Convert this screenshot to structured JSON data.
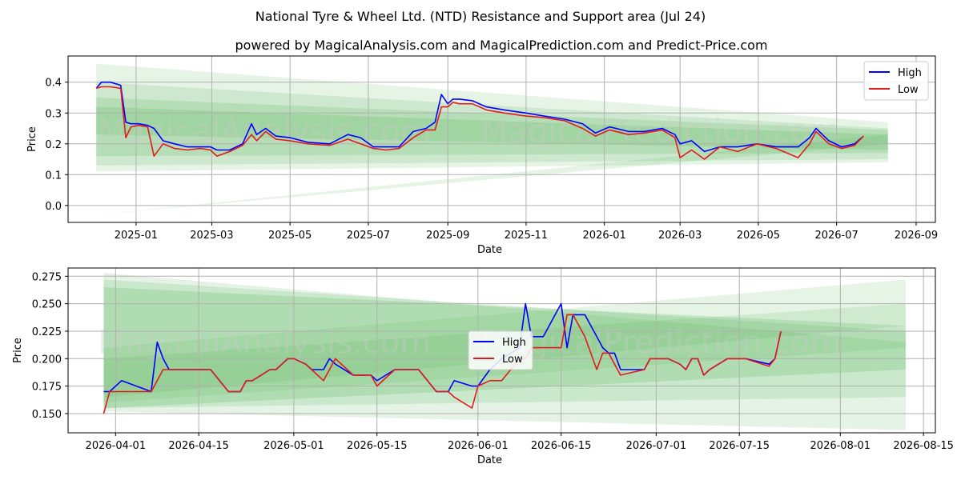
{
  "title": "National Tyre & Wheel Ltd. (NTD) Resistance and Support area (Jul 24)",
  "subtitle": "powered by MagicalAnalysis.com and MagicalPrediction.com and Predict-Price.com",
  "watermark_left": "MagicalAnalysis.com",
  "watermark_right": "MagicalPrediction.com",
  "colors": {
    "high": "#0000ff",
    "low": "#e31a1c",
    "band": "#4caf50",
    "grid": "#b0b0b0"
  },
  "chart_data": [
    {
      "type": "line",
      "xlabel": "Date",
      "ylabel": "Price",
      "ylim": [
        -0.055,
        0.485
      ],
      "xlim": [
        "2024-11-09",
        "2026-09-16"
      ],
      "yticks": [
        "0.0",
        "0.1",
        "0.2",
        "0.3",
        "0.4"
      ],
      "xticks": [
        "2025-01",
        "2025-03",
        "2025-05",
        "2025-07",
        "2025-09",
        "2025-11",
        "2026-01",
        "2026-03",
        "2026-05",
        "2026-07",
        "2026-09"
      ],
      "grid": true,
      "legend": {
        "position": "top-right",
        "entries": [
          "High",
          "Low"
        ]
      },
      "bands": [
        {
          "x0": "2024-12-01",
          "x1": "2026-08-10",
          "top0": 0.46,
          "top1": 0.27,
          "bot0": 0.11,
          "bot1": 0.14,
          "opacity": 0.14
        },
        {
          "x0": "2024-12-01",
          "x1": "2026-08-10",
          "top0": 0.4,
          "top1": 0.25,
          "bot0": 0.13,
          "bot1": 0.15,
          "opacity": 0.16
        },
        {
          "x0": "2024-12-01",
          "x1": "2026-08-10",
          "top0": 0.35,
          "top1": 0.245,
          "bot0": 0.16,
          "bot1": 0.17,
          "opacity": 0.18
        },
        {
          "x0": "2024-12-01",
          "x1": "2026-08-10",
          "top0": 0.32,
          "top1": 0.23,
          "bot0": 0.23,
          "bot1": 0.18,
          "opacity": 0.2
        },
        {
          "x0": "2024-12-01",
          "x1": "2026-08-10",
          "top0": -0.03,
          "top1": 0.23,
          "bot0": -0.03,
          "bot1": 0.2,
          "opacity": 0.14
        }
      ],
      "series": [
        {
          "name": "High",
          "x": [
            "2024-12-01",
            "2024-12-05",
            "2024-12-12",
            "2024-12-20",
            "2024-12-24",
            "2024-12-28",
            "2025-01-03",
            "2025-01-10",
            "2025-01-15",
            "2025-01-22",
            "2025-01-31",
            "2025-02-10",
            "2025-02-20",
            "2025-02-28",
            "2025-03-05",
            "2025-03-15",
            "2025-03-25",
            "2025-04-01",
            "2025-04-05",
            "2025-04-12",
            "2025-04-20",
            "2025-05-01",
            "2025-05-15",
            "2025-06-01",
            "2025-06-15",
            "2025-06-25",
            "2025-07-05",
            "2025-07-15",
            "2025-07-25",
            "2025-08-05",
            "2025-08-15",
            "2025-08-22",
            "2025-08-27",
            "2025-09-01",
            "2025-09-05",
            "2025-09-10",
            "2025-09-20",
            "2025-10-01",
            "2025-10-15",
            "2025-11-01",
            "2025-11-15",
            "2025-12-01",
            "2025-12-15",
            "2025-12-25",
            "2026-01-05",
            "2026-01-20",
            "2026-02-01",
            "2026-02-15",
            "2026-02-25",
            "2026-03-01",
            "2026-03-10",
            "2026-03-20",
            "2026-04-01",
            "2026-04-15",
            "2026-04-30",
            "2026-05-15",
            "2026-06-01",
            "2026-06-10",
            "2026-06-15",
            "2026-06-25",
            "2026-07-05",
            "2026-07-15",
            "2026-07-22"
          ],
          "values": [
            0.38,
            0.4,
            0.4,
            0.39,
            0.27,
            0.265,
            0.265,
            0.26,
            0.25,
            0.21,
            0.2,
            0.19,
            0.19,
            0.19,
            0.18,
            0.18,
            0.2,
            0.265,
            0.23,
            0.25,
            0.225,
            0.22,
            0.205,
            0.2,
            0.23,
            0.22,
            0.19,
            0.19,
            0.19,
            0.24,
            0.25,
            0.27,
            0.36,
            0.33,
            0.345,
            0.345,
            0.34,
            0.32,
            0.31,
            0.3,
            0.29,
            0.28,
            0.265,
            0.235,
            0.255,
            0.24,
            0.24,
            0.25,
            0.23,
            0.2,
            0.21,
            0.175,
            0.19,
            0.19,
            0.2,
            0.19,
            0.19,
            0.22,
            0.25,
            0.21,
            0.19,
            0.2,
            0.225
          ]
        },
        {
          "name": "Low",
          "x": [
            "2024-12-01",
            "2024-12-05",
            "2024-12-12",
            "2024-12-20",
            "2024-12-24",
            "2024-12-28",
            "2025-01-03",
            "2025-01-10",
            "2025-01-15",
            "2025-01-22",
            "2025-01-31",
            "2025-02-10",
            "2025-02-20",
            "2025-02-28",
            "2025-03-05",
            "2025-03-15",
            "2025-03-25",
            "2025-04-01",
            "2025-04-05",
            "2025-04-12",
            "2025-04-20",
            "2025-05-01",
            "2025-05-15",
            "2025-06-01",
            "2025-06-15",
            "2025-06-25",
            "2025-07-05",
            "2025-07-15",
            "2025-07-25",
            "2025-08-05",
            "2025-08-15",
            "2025-08-22",
            "2025-08-27",
            "2025-09-01",
            "2025-09-05",
            "2025-09-10",
            "2025-09-20",
            "2025-10-01",
            "2025-10-15",
            "2025-11-01",
            "2025-11-15",
            "2025-12-01",
            "2025-12-15",
            "2025-12-25",
            "2026-01-05",
            "2026-01-20",
            "2026-02-01",
            "2026-02-15",
            "2026-02-25",
            "2026-03-01",
            "2026-03-10",
            "2026-03-20",
            "2026-04-01",
            "2026-04-15",
            "2026-04-30",
            "2026-05-15",
            "2026-06-01",
            "2026-06-10",
            "2026-06-15",
            "2026-06-25",
            "2026-07-05",
            "2026-07-15",
            "2026-07-22"
          ],
          "values": [
            0.38,
            0.385,
            0.385,
            0.38,
            0.22,
            0.255,
            0.26,
            0.255,
            0.16,
            0.2,
            0.185,
            0.18,
            0.185,
            0.18,
            0.16,
            0.175,
            0.195,
            0.23,
            0.21,
            0.24,
            0.215,
            0.21,
            0.2,
            0.195,
            0.215,
            0.2,
            0.185,
            0.18,
            0.185,
            0.22,
            0.245,
            0.245,
            0.32,
            0.32,
            0.335,
            0.33,
            0.33,
            0.31,
            0.3,
            0.29,
            0.285,
            0.275,
            0.25,
            0.225,
            0.245,
            0.23,
            0.235,
            0.245,
            0.22,
            0.155,
            0.18,
            0.15,
            0.19,
            0.175,
            0.2,
            0.185,
            0.155,
            0.2,
            0.24,
            0.2,
            0.185,
            0.195,
            0.225
          ]
        }
      ]
    },
    {
      "type": "line",
      "xlabel": "Date",
      "ylabel": "Price",
      "ylim": [
        0.1325,
        0.2825
      ],
      "xlim": [
        "2026-03-24",
        "2026-08-17"
      ],
      "yticks": [
        "0.150",
        "0.175",
        "0.200",
        "0.225",
        "0.250",
        "0.275"
      ],
      "xticks": [
        "2026-04-01",
        "2026-04-15",
        "2026-05-01",
        "2026-05-15",
        "2026-06-01",
        "2026-06-15",
        "2026-07-01",
        "2026-07-15",
        "2026-08-01",
        "2026-08-15"
      ],
      "grid": true,
      "legend": {
        "position": "center",
        "entries": [
          "High",
          "Low"
        ]
      },
      "bands": [
        {
          "x0": "2026-03-30",
          "x1": "2026-08-12",
          "top0": 0.278,
          "top1": 0.215,
          "bot0": 0.152,
          "bot1": 0.135,
          "opacity": 0.15
        },
        {
          "x0": "2026-03-30",
          "x1": "2026-08-12",
          "top0": 0.272,
          "top1": 0.225,
          "bot0": 0.155,
          "bot1": 0.165,
          "opacity": 0.17
        },
        {
          "x0": "2026-03-30",
          "x1": "2026-08-12",
          "top0": 0.265,
          "top1": 0.23,
          "bot0": 0.155,
          "bot1": 0.19,
          "opacity": 0.2
        },
        {
          "x0": "2026-03-30",
          "x1": "2026-08-12",
          "top0": 0.21,
          "top1": 0.272,
          "bot0": 0.16,
          "bot1": 0.21,
          "opacity": 0.14
        },
        {
          "x0": "2026-03-30",
          "x1": "2026-08-12",
          "top0": 0.2,
          "top1": 0.25,
          "bot0": 0.165,
          "bot1": 0.23,
          "opacity": 0.14
        }
      ],
      "series": [
        {
          "name": "High",
          "x": [
            "2026-03-30",
            "2026-03-31",
            "2026-04-02",
            "2026-04-07",
            "2026-04-08",
            "2026-04-09",
            "2026-04-10",
            "2026-04-17",
            "2026-04-20",
            "2026-04-22",
            "2026-04-23",
            "2026-04-24",
            "2026-04-27",
            "2026-04-28",
            "2026-04-30",
            "2026-05-01",
            "2026-05-03",
            "2026-05-04",
            "2026-05-06",
            "2026-05-07",
            "2026-05-08",
            "2026-05-11",
            "2026-05-13",
            "2026-05-14",
            "2026-05-15",
            "2026-05-18",
            "2026-05-22",
            "2026-05-25",
            "2026-05-27",
            "2026-05-28",
            "2026-05-31",
            "2026-06-01",
            "2026-06-03",
            "2026-06-05",
            "2026-06-08",
            "2026-06-09",
            "2026-06-10",
            "2026-06-11",
            "2026-06-12",
            "2026-06-15",
            "2026-06-16",
            "2026-06-17",
            "2026-06-19",
            "2026-06-21",
            "2026-06-22",
            "2026-06-23",
            "2026-06-24",
            "2026-06-25",
            "2026-06-29",
            "2026-06-30",
            "2026-07-03",
            "2026-07-05",
            "2026-07-06",
            "2026-07-07",
            "2026-07-08",
            "2026-07-09",
            "2026-07-10",
            "2026-07-13",
            "2026-07-16",
            "2026-07-20",
            "2026-07-21",
            "2026-07-22"
          ],
          "values": [
            0.17,
            0.17,
            0.18,
            0.17,
            0.215,
            0.2,
            0.19,
            0.19,
            0.17,
            0.17,
            0.18,
            0.18,
            0.19,
            0.19,
            0.2,
            0.2,
            0.195,
            0.19,
            0.19,
            0.2,
            0.195,
            0.185,
            0.185,
            0.185,
            0.18,
            0.19,
            0.19,
            0.17,
            0.17,
            0.18,
            0.175,
            0.175,
            0.19,
            0.2,
            0.21,
            0.25,
            0.22,
            0.22,
            0.22,
            0.25,
            0.21,
            0.24,
            0.24,
            0.22,
            0.21,
            0.205,
            0.205,
            0.19,
            0.19,
            0.2,
            0.2,
            0.195,
            0.19,
            0.2,
            0.2,
            0.185,
            0.19,
            0.2,
            0.2,
            0.195,
            0.2,
            0.225
          ]
        },
        {
          "name": "Low",
          "x": [
            "2026-03-30",
            "2026-03-31",
            "2026-04-02",
            "2026-04-07",
            "2026-04-08",
            "2026-04-09",
            "2026-04-10",
            "2026-04-17",
            "2026-04-20",
            "2026-04-22",
            "2026-04-23",
            "2026-04-24",
            "2026-04-27",
            "2026-04-28",
            "2026-04-30",
            "2026-05-01",
            "2026-05-03",
            "2026-05-04",
            "2026-05-06",
            "2026-05-07",
            "2026-05-08",
            "2026-05-11",
            "2026-05-13",
            "2026-05-14",
            "2026-05-15",
            "2026-05-18",
            "2026-05-22",
            "2026-05-25",
            "2026-05-27",
            "2026-05-28",
            "2026-05-31",
            "2026-06-01",
            "2026-06-03",
            "2026-06-05",
            "2026-06-08",
            "2026-06-09",
            "2026-06-10",
            "2026-06-11",
            "2026-06-12",
            "2026-06-15",
            "2026-06-16",
            "2026-06-17",
            "2026-06-19",
            "2026-06-21",
            "2026-06-22",
            "2026-06-23",
            "2026-06-24",
            "2026-06-25",
            "2026-06-29",
            "2026-06-30",
            "2026-07-03",
            "2026-07-05",
            "2026-07-06",
            "2026-07-07",
            "2026-07-08",
            "2026-07-09",
            "2026-07-10",
            "2026-07-13",
            "2026-07-16",
            "2026-07-20",
            "2026-07-21",
            "2026-07-22"
          ],
          "values": [
            0.15,
            0.17,
            0.17,
            0.17,
            0.18,
            0.19,
            0.19,
            0.19,
            0.17,
            0.17,
            0.18,
            0.18,
            0.19,
            0.19,
            0.2,
            0.2,
            0.195,
            0.19,
            0.18,
            0.19,
            0.2,
            0.185,
            0.185,
            0.185,
            0.175,
            0.19,
            0.19,
            0.17,
            0.17,
            0.165,
            0.155,
            0.175,
            0.18,
            0.18,
            0.2,
            0.2,
            0.21,
            0.21,
            0.21,
            0.21,
            0.24,
            0.24,
            0.22,
            0.19,
            0.205,
            0.205,
            0.195,
            0.185,
            0.19,
            0.2,
            0.2,
            0.195,
            0.19,
            0.2,
            0.2,
            0.185,
            0.19,
            0.2,
            0.2,
            0.193,
            0.2,
            0.225
          ]
        }
      ]
    }
  ]
}
